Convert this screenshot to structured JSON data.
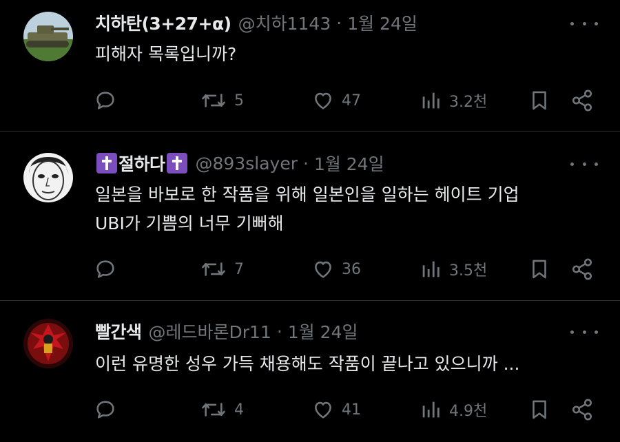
{
  "tweets": [
    {
      "name": "치하탄(3+27+α)",
      "handle": "@치하1143",
      "date": "1월 24일",
      "text": "피해자 목록입니까?",
      "replies": "",
      "retweets": "5",
      "likes": "47",
      "views": "3.2천"
    },
    {
      "name": "절하다",
      "handle": "@893slayer",
      "date": "1월 24일",
      "text": "일본을 바보로 한 작품을 위해 일본인을 일하는 헤이트 기업\nUBI가 기쁨의 너무 기뻐해",
      "replies": "",
      "retweets": "7",
      "likes": "36",
      "views": "3.5천"
    },
    {
      "name": "빨간색",
      "handle": "@레드바론Dr11",
      "date": "1월 24일",
      "text": "이런 유명한 성우 가득 채용해도 작품이 끝나고 있으니까 ...",
      "replies": "",
      "retweets": "4",
      "likes": "41",
      "views": "4.9천"
    }
  ],
  "sep": "·",
  "colors": {
    "background": "#000000",
    "text": "#e7e9ea",
    "muted": "#71767b",
    "divider": "#2f3336",
    "cross_badge": "#7c4dbd"
  },
  "icons": [
    "reply-icon",
    "retweet-icon",
    "like-icon",
    "views-icon",
    "bookmark-icon",
    "share-icon",
    "more-icon"
  ]
}
